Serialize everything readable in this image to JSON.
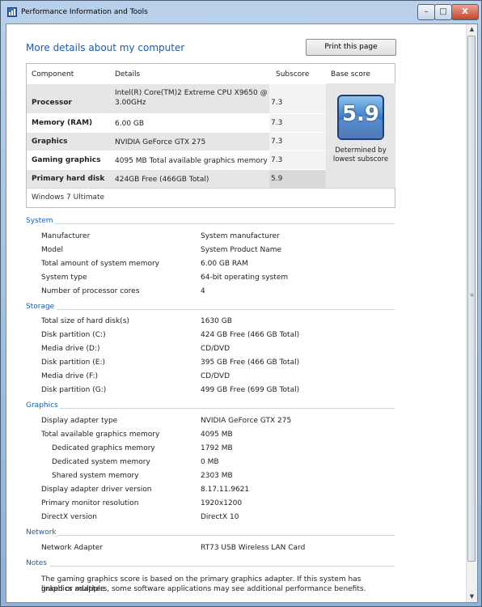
{
  "window": {
    "title": "Performance Information and Tools",
    "minimize": "–",
    "maximize": "□",
    "close": "X"
  },
  "page": {
    "heading": "More details about my computer",
    "print_button": "Print this page"
  },
  "score_table": {
    "headers": {
      "component": "Component",
      "details": "Details",
      "subscore": "Subscore",
      "base": "Base score"
    },
    "rows": [
      {
        "label": "Processor",
        "detail1": "Intel(R) Core(TM)2 Extreme CPU X9650 @",
        "detail2": "3.00GHz",
        "sub": "7.3"
      },
      {
        "label": "Memory (RAM)",
        "detail1": "6.00 GB",
        "detail2": "",
        "sub": "7.3"
      },
      {
        "label": "Graphics",
        "detail1": "NVIDIA GeForce GTX 275",
        "detail2": "",
        "sub": "7.3"
      },
      {
        "label": "Gaming graphics",
        "detail1": "4095 MB Total available graphics memory",
        "detail2": "",
        "sub": "7.3"
      },
      {
        "label": "Primary hard disk",
        "detail1": "424GB Free (466GB Total)",
        "detail2": "",
        "sub": "5.9"
      }
    ],
    "base_score": "5.9",
    "base_caption1": "Determined by",
    "base_caption2": "lowest subscore",
    "edition": "Windows 7 Ultimate"
  },
  "sections": {
    "system": {
      "title": "System",
      "items": [
        {
          "label": "Manufacturer",
          "value": "System manufacturer"
        },
        {
          "label": "Model",
          "value": "System Product Name"
        },
        {
          "label": "Total amount of system memory",
          "value": "6.00 GB RAM"
        },
        {
          "label": "System type",
          "value": "64-bit operating system"
        },
        {
          "label": "Number of processor cores",
          "value": "4"
        }
      ]
    },
    "storage": {
      "title": "Storage",
      "items": [
        {
          "label": "Total size of hard disk(s)",
          "value": "1630 GB"
        },
        {
          "label": "Disk partition (C:)",
          "value": "424 GB Free (466 GB Total)"
        },
        {
          "label": "Media drive (D:)",
          "value": "CD/DVD"
        },
        {
          "label": "Disk partition (E:)",
          "value": "395 GB Free (466 GB Total)"
        },
        {
          "label": "Media drive (F:)",
          "value": "CD/DVD"
        },
        {
          "label": "Disk partition (G:)",
          "value": "499 GB Free (699 GB Total)"
        }
      ]
    },
    "graphics": {
      "title": "Graphics",
      "items": [
        {
          "label": "Display adapter type",
          "value": "NVIDIA GeForce GTX 275"
        },
        {
          "label": "Total available graphics memory",
          "value": "4095 MB"
        },
        {
          "label": "Dedicated graphics memory",
          "value": "1792 MB"
        },
        {
          "label": "Dedicated system memory",
          "value": "0 MB"
        },
        {
          "label": "Shared system memory",
          "value": "2303 MB"
        },
        {
          "label": "Display adapter driver version",
          "value": "8.17.11.9621"
        },
        {
          "label": "Primary monitor resolution",
          "value": "1920x1200"
        },
        {
          "label": "DirectX version",
          "value": "DirectX 10"
        }
      ]
    },
    "network": {
      "title": "Network",
      "items": [
        {
          "label": "Network Adapter",
          "value": "RT73 USB Wireless LAN Card"
        }
      ]
    },
    "notes": {
      "title": "Notes",
      "line1": "The gaming graphics score is based on the primary graphics adapter. If this system has linked or multiple",
      "line2": "graphics adapters, some software applications may see additional performance benefits."
    }
  },
  "colors": {
    "heading": "#1e5aa8",
    "badge": "#2f70bf",
    "row_shade": "#e6e6e6"
  }
}
